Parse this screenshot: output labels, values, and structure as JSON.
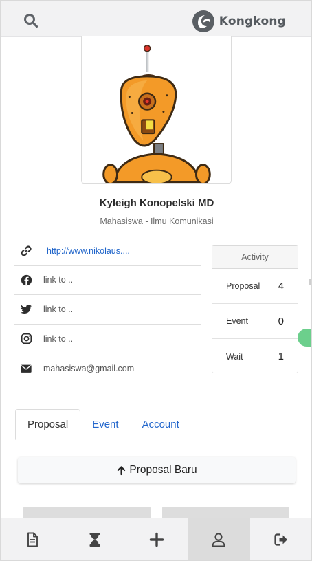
{
  "app": {
    "brand_name": "Kongkong",
    "accent_color": "#2266cc",
    "handle_color": "#6ccf8c"
  },
  "profile": {
    "name": "Kyleigh Konopelski MD",
    "role": "Mahasiswa - Ilmu Komunikasi",
    "avatar": "orange-robot-avatar"
  },
  "links": [
    {
      "icon": "link-icon",
      "text": "http://www.nikolaus...."
    },
    {
      "icon": "facebook-icon",
      "text": "link to .."
    },
    {
      "icon": "twitter-icon",
      "text": "link to .."
    },
    {
      "icon": "instagram-icon",
      "text": "link to .."
    },
    {
      "icon": "envelope-icon",
      "text": "mahasiswa@gmail.com"
    }
  ],
  "activity": {
    "title": "Activity",
    "rows": [
      {
        "label": "Proposal",
        "count": "4"
      },
      {
        "label": "Event",
        "count": "0"
      },
      {
        "label": "Wait",
        "count": "1"
      }
    ]
  },
  "tabs": [
    {
      "label": "Proposal",
      "active": true
    },
    {
      "label": "Event",
      "active": false
    },
    {
      "label": "Account",
      "active": false
    }
  ],
  "new_proposal": {
    "label": "Proposal Baru",
    "icon": "arrow-up-icon"
  },
  "bottom_nav": [
    {
      "icon": "document-icon",
      "active": false
    },
    {
      "icon": "hourglass-icon",
      "active": false
    },
    {
      "icon": "plus-icon",
      "active": false
    },
    {
      "icon": "user-icon",
      "active": true
    },
    {
      "icon": "sign-out-icon",
      "active": false
    }
  ]
}
